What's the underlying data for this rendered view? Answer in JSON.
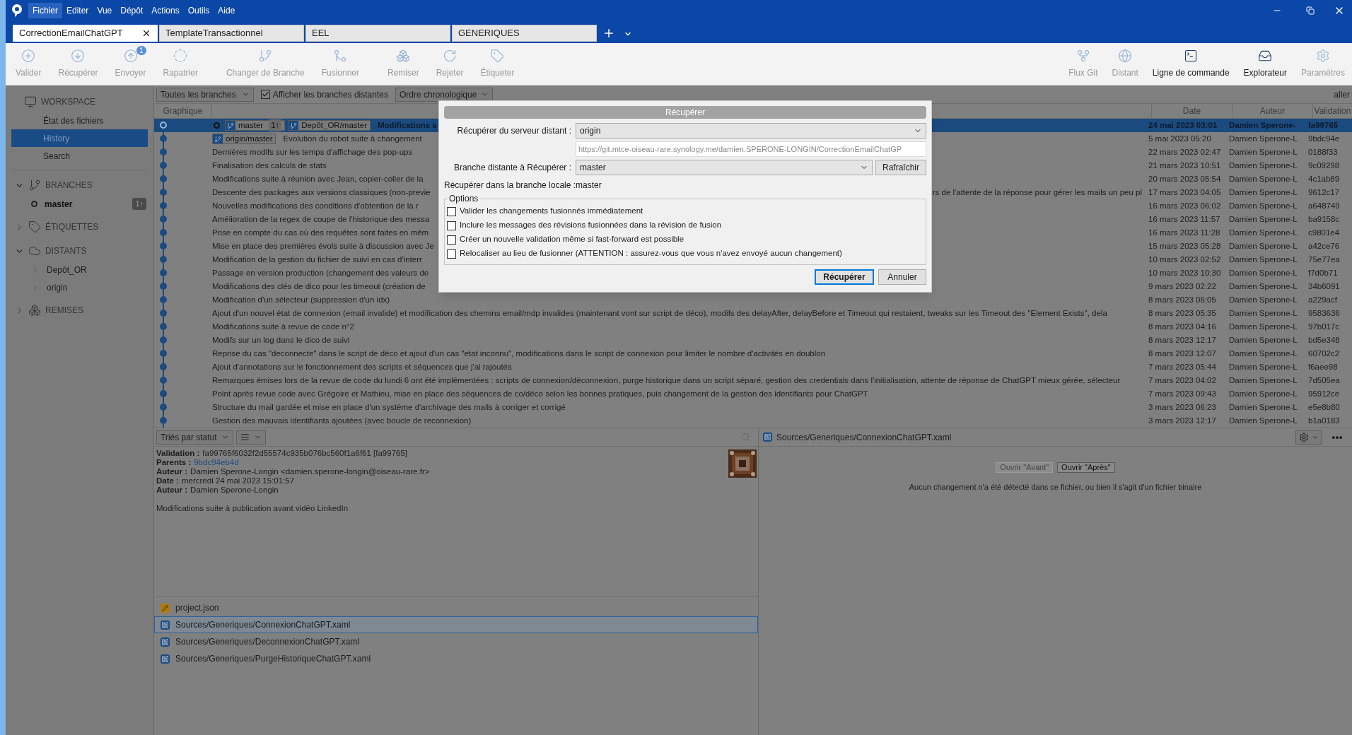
{
  "menu": [
    {
      "label": "Fichier",
      "selected": true
    },
    {
      "label": "Editer",
      "selected": false
    },
    {
      "label": "Vue",
      "selected": false
    },
    {
      "label": "Dépôt",
      "selected": false
    },
    {
      "label": "Actions",
      "selected": false
    },
    {
      "label": "Outils",
      "selected": false
    },
    {
      "label": "Aide",
      "selected": false
    }
  ],
  "tabs": [
    {
      "label": "CorrectionEmailChatGPT",
      "selected": true
    },
    {
      "label": "TemplateTransactionnel",
      "selected": false
    },
    {
      "label": "EEL",
      "selected": false
    },
    {
      "label": "GENERIQUES",
      "selected": false
    }
  ],
  "toolbar": {
    "left": [
      {
        "label": "Valider",
        "disabled": true
      },
      {
        "label": "Récupérer",
        "disabled": true
      },
      {
        "label": "Envoyer",
        "disabled": true,
        "badge": "1"
      },
      {
        "label": "Rapatrier",
        "disabled": true
      },
      {
        "label": "Changer de Branche",
        "disabled": true
      },
      {
        "label": "Fusionner",
        "disabled": true
      },
      {
        "label": "Remiser",
        "disabled": true
      },
      {
        "label": "Rejeter",
        "disabled": true
      },
      {
        "label": "Étiqueter",
        "disabled": true
      }
    ],
    "right": [
      {
        "label": "Flux Git",
        "disabled": true
      },
      {
        "label": "Distant",
        "disabled": true
      },
      {
        "label": "Ligne de commande",
        "disabled": false
      },
      {
        "label": "Explorateur",
        "disabled": false
      },
      {
        "label": "Paramètres",
        "disabled": true
      }
    ]
  },
  "sidebar": {
    "workspace": {
      "title": "WORKSPACE",
      "items": [
        {
          "label": "État des fichiers",
          "selected": false
        },
        {
          "label": "History",
          "selected": true
        },
        {
          "label": "Search",
          "selected": false
        }
      ]
    },
    "sections": [
      {
        "kind": "branches",
        "title": "BRANCHES",
        "expanded": true,
        "items": [
          {
            "label": "master",
            "current": true,
            "badge": "1↑"
          }
        ]
      },
      {
        "kind": "tags",
        "title": "ÉTIQUETTES",
        "expanded": false
      },
      {
        "kind": "remotes",
        "title": "DISTANTS",
        "expanded": true,
        "items": [
          {
            "label": "Depôt_OR",
            "expanded": false
          },
          {
            "label": "origin",
            "expanded": false
          }
        ]
      },
      {
        "kind": "stashes",
        "title": "REMISES",
        "expanded": false
      }
    ]
  },
  "filters": {
    "branches": "Toutes les branches",
    "show_remote": {
      "label": "Afficher les branches distantes",
      "checked": true
    },
    "order": "Ordre chronologique",
    "jump": "aller"
  },
  "columns": [
    "Graphique",
    "Date",
    "Auteur",
    "Validation"
  ],
  "commits": [
    {
      "message": "Modifications s",
      "refs": [
        {
          "label": "master",
          "badge": "1↑"
        },
        {
          "label": "Depôt_OR/master"
        }
      ],
      "head": true,
      "selected": true,
      "date": "24 mai 2023 03:01",
      "author": "Damien Sperone-",
      "hash": "fa99765"
    },
    {
      "message": "Evolution du robot suite à changement",
      "refs": [
        {
          "label": "origin/master"
        }
      ],
      "head": false,
      "selected": false,
      "date": "5 mai 2023 05:20",
      "author": "Damien Sperone-L",
      "hash": "9bdc94e"
    },
    {
      "message": "Dernières modifs sur les temps d'affichage des pop-ups",
      "head": false,
      "selected": false,
      "date": "22 mars 2023 02:47",
      "author": "Damien Sperone-L",
      "hash": "0188f33"
    },
    {
      "message": "Finalisation des calculs de stats",
      "head": false,
      "selected": false,
      "date": "21 mars 2023 10:51",
      "author": "Damien Sperone-L",
      "hash": "9c09298"
    },
    {
      "message": "Modifications suite à réunion avec Jean, copier-coller de la",
      "head": false,
      "selected": false,
      "date": "20 mars 2023 05:54",
      "author": "Damien Sperone-L",
      "hash": "4c1ab89"
    },
    {
      "message": "Descente des packages aux versions classiques (non-previe",
      "message_right": "rs de l'attente de la réponse pour gérer les mails un peu pl",
      "head": false,
      "selected": false,
      "date": "17 mars 2023 04:05",
      "author": "Damien Sperone-L",
      "hash": "9612c17"
    },
    {
      "message": "Nouvelles modifications des conditions d'obtention de la r",
      "head": false,
      "selected": false,
      "date": "16 mars 2023 06:02",
      "author": "Damien Sperone-L",
      "hash": "a648749"
    },
    {
      "message": "Amélioration de la regex de coupe de l'historique des messa",
      "head": false,
      "selected": false,
      "date": "16 mars 2023 11:57",
      "author": "Damien Sperone-L",
      "hash": "ba9158c"
    },
    {
      "message": "Prise en compte du cas où des requêtes sont faites en mêm",
      "head": false,
      "selected": false,
      "date": "16 mars 2023 11:28",
      "author": "Damien Sperone-L",
      "hash": "c9801e4"
    },
    {
      "message": "Mise en place des premières évols suite à discussion avec Je",
      "head": false,
      "selected": false,
      "date": "15 mars 2023 05:28",
      "author": "Damien Sperone-L",
      "hash": "a42ce76"
    },
    {
      "message": "Modification de la gestion du fichier de suivi en cas d'interr",
      "head": false,
      "selected": false,
      "date": "10 mars 2023 02:52",
      "author": "Damien Sperone-L",
      "hash": "75e77ea"
    },
    {
      "message": "Passage en version production (changement des valeurs de",
      "head": false,
      "selected": false,
      "date": "10 mars 2023 10:30",
      "author": "Damien Sperone-L",
      "hash": "f7d0b71"
    },
    {
      "message": "Modifications des clés de dico pour les timeout (création de",
      "head": false,
      "selected": false,
      "date": "9 mars 2023 02:22",
      "author": "Damien Sperone-L",
      "hash": "34b6091"
    },
    {
      "message": "Modification d'un sélecteur (suppression d'un idx)",
      "head": false,
      "selected": false,
      "date": "8 mars 2023 06:05",
      "author": "Damien Sperone-L",
      "hash": "a229acf"
    },
    {
      "message": "Ajout d'un nouvel état de connexion (email invalide) et modification des chemins email/mdp invalides (maintenant vont sur script de déco), modifs des delayAfter, delayBefore et Timeout qui restaient, tweaks sur les Timeout des \"Element Exists\", dela",
      "head": false,
      "selected": false,
      "date": "8 mars 2023 05:35",
      "author": "Damien Sperone-L",
      "hash": "9583636"
    },
    {
      "message": "Modifications suite à revue de code n°2",
      "head": false,
      "selected": false,
      "date": "8 mars 2023 04:16",
      "author": "Damien Sperone-L",
      "hash": "97b017c"
    },
    {
      "message": "Modifs sur un log dans le dico de suivi",
      "head": false,
      "selected": false,
      "date": "8 mars 2023 12:17",
      "author": "Damien Sperone-L",
      "hash": "bd5e348"
    },
    {
      "message": "Reprise du cas \"deconnecte\" dans le script de déco et ajout d'un cas \"etat inconnu\", modifications dans le script de connexion pour limiter le nombre d'activités en doublon",
      "head": false,
      "selected": false,
      "date": "8 mars 2023 12:07",
      "author": "Damien Sperone-L",
      "hash": "60702c2"
    },
    {
      "message": "Ajout d'annotations sur le fonctionnement des scripts et séquences que j'ai rajoutés",
      "head": false,
      "selected": false,
      "date": "7 mars 2023 05:44",
      "author": "Damien Sperone-L",
      "hash": "f6aee98"
    },
    {
      "message": "Remarques émises lors de la revue de code du lundi 6 ont été implémentées : scripts de connexion/déconnexion, purge historique dans un script séparé, gestion des credentials dans l'initialisation, attente de réponse de ChatGPT mieux gérée, sélecteur",
      "head": false,
      "selected": false,
      "date": "7 mars 2023 04:02",
      "author": "Damien Sperone-L",
      "hash": "7d505ea"
    },
    {
      "message": "Point après revue code avec Grégoire et Mathieu, mise en place des séquences de co/déco selon les bonnes pratiques, puis changement de la gestion des identifiants pour ChatGPT",
      "head": false,
      "selected": false,
      "date": "7 mars 2023 09:43",
      "author": "Damien Sperone-L",
      "hash": "95912ce"
    },
    {
      "message": "Structure du mail gardée et mise en place d'un système d'archivage des mails à corriger et corrigé",
      "head": false,
      "selected": false,
      "date": "3 mars 2023 06:23",
      "author": "Damien Sperone-L",
      "hash": "e5e8b80"
    },
    {
      "message": "Gestion des mauvais identifiants ajoutées (avec boucle de reconnexion)",
      "head": false,
      "selected": false,
      "date": "3 mars 2023 12:17",
      "author": "Damien Sperone-L",
      "hash": "b1a0183"
    }
  ],
  "details": {
    "sort": "Triés par statut",
    "fields": [
      {
        "label": "Validation :",
        "value": "fa99765f6032f2d55574c935b076bc560f1a6f61 [fa99765]",
        "kind": "text"
      },
      {
        "label": "Parents :",
        "value": "9bdc94eb4d",
        "kind": "link"
      },
      {
        "label": "Auteur :",
        "value": "Damien Sperone-Longin <damien.sperone-longin@oiseau-rare.fr>",
        "kind": "text"
      },
      {
        "label": "Date :",
        "value": "mercredi 24 mai 2023 15:01:57",
        "kind": "text"
      },
      {
        "label": "Auteur :",
        "value": "Damien Sperone-Longin",
        "kind": "text"
      }
    ],
    "message": "Modifications suite à publication avant vidéo LinkedIn",
    "files": [
      {
        "name": "project.json",
        "kind": "json",
        "selected": false
      },
      {
        "name": "Sources/Generiques/ConnexionChatGPT.xaml",
        "kind": "xaml",
        "selected": true
      },
      {
        "name": "Sources/Generiques/DeconnexionChatGPT.xaml",
        "kind": "xaml",
        "selected": false
      },
      {
        "name": "Sources/Generiques/PurgeHistoriqueChatGPT.xaml",
        "kind": "xaml",
        "selected": false
      }
    ]
  },
  "diff": {
    "path": "Sources/Generiques/ConnexionChatGPT.xaml",
    "buttons": [
      {
        "label": "Ouvrir \"Avant\"",
        "disabled": true
      },
      {
        "label": "Ouvrir \"Après\"",
        "disabled": false
      }
    ],
    "message": "Aucun changement n'a été détecté dans ce fichier, ou bien il s'agit d'un fichier binaire"
  },
  "dialog": {
    "title": "Récupérer",
    "remote": {
      "label": "Récupérer du serveur distant :",
      "value": "origin"
    },
    "url": "https://git.mtce-oiseau-rare.synology.me/damien.SPERONE-LONGIN/CorrectionEmailChatGP",
    "branch": {
      "label": "Branche distante à Récupérer :",
      "value": "master"
    },
    "refresh": "Rafraîchir",
    "local": {
      "label": "Récupérer dans la branche locale :",
      "value": "master"
    },
    "options_title": "Options",
    "options": [
      {
        "label": "Valider les changements fusionnés immédiatement",
        "checked": false
      },
      {
        "label": "Inclure les messages des révisions fusionnées dans la révision de fusion",
        "checked": false
      },
      {
        "label": "Créer un nouvelle validation même si fast-forward est possible",
        "checked": false
      },
      {
        "label": "Relocaliser au lieu de fusionner (ATTENTION : assurez-vous que vous n'avez envoyé aucun changement)",
        "checked": false
      }
    ],
    "buttons": [
      {
        "label": "Récupérer",
        "primary": true
      },
      {
        "label": "Annuler",
        "primary": false
      }
    ]
  }
}
